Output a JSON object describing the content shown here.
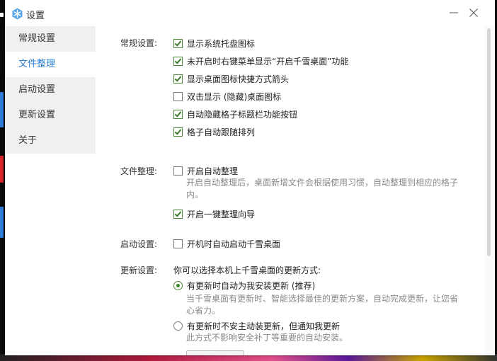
{
  "window": {
    "title": "设置"
  },
  "sidebar": {
    "items": [
      {
        "label": "常规设置",
        "active": false
      },
      {
        "label": "文件整理",
        "active": true
      },
      {
        "label": "启动设置",
        "active": false
      },
      {
        "label": "更新设置",
        "active": false
      },
      {
        "label": "关于",
        "active": false
      }
    ]
  },
  "general": {
    "label": "常规设置:",
    "options": [
      {
        "label": "显示系统托盘图标",
        "checked": true
      },
      {
        "label": "未开启时右键菜单显示“开启千雪桌面”功能",
        "checked": true
      },
      {
        "label": "显示桌面图标快捷方式箭头",
        "checked": true
      },
      {
        "label": "双击显示 (隐藏)桌面图标",
        "checked": false
      },
      {
        "label": "自动隐藏格子标题栏功能按钮",
        "checked": true
      },
      {
        "label": "格子自动跟随排列",
        "checked": true
      }
    ]
  },
  "organize": {
    "label": "文件整理:",
    "auto_label": "开启自动整理",
    "auto_checked": false,
    "auto_desc": "开启自动整理后，桌面新增文件会根据使用习惯，自动整理到相应的格子内。",
    "wizard_label": "开启一键整理向导",
    "wizard_checked": true
  },
  "startup": {
    "label": "启动设置:",
    "option_label": "开机时自动启动千雪桌面",
    "checked": false
  },
  "update": {
    "label": "更新设置:",
    "intro": "你可以选择本机上千雪桌面的更新方式:",
    "options": [
      {
        "label": "有更新时自动为我安装更新 (推荐)",
        "selected": true,
        "desc": "当千雪桌面有更新时、智能选择最佳的更新方案，自动完成更新，让您省心省力。"
      },
      {
        "label": "有更新时不安主动装更新，但通知我更新",
        "selected": false,
        "desc": "此方式不影响安全补丁等重要的自动安装。"
      }
    ]
  },
  "colors": {
    "accent": "#2a7fd4",
    "check": "#3b7a2a",
    "sidebar_bg": "#f0f0f0"
  },
  "icons": {
    "app": "snowflake-icon",
    "minimize": "minimize-icon",
    "close": "close-icon"
  }
}
